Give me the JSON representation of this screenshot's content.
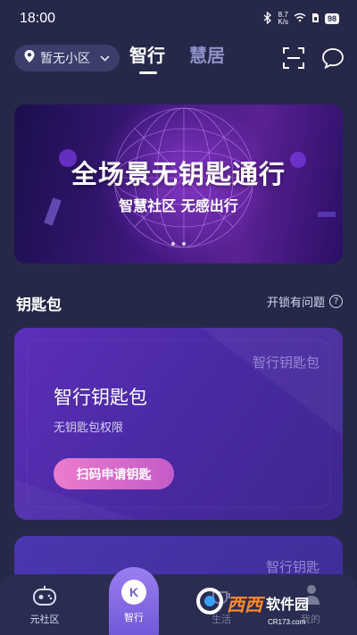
{
  "status_bar": {
    "time": "18:00",
    "speed_value": "8.7",
    "speed_unit": "K/s",
    "battery": "98"
  },
  "header": {
    "community": "暂无小区",
    "tabs": [
      {
        "label": "智行",
        "active": true
      },
      {
        "label": "慧居",
        "active": false
      }
    ],
    "icons": [
      "scan-icon",
      "message-icon"
    ]
  },
  "banner": {
    "title": "全场景无钥匙通行",
    "subtitle": "智慧社区 无感出行",
    "pages": 2
  },
  "key_wallet": {
    "section_title": "钥匙包",
    "help_label": "开锁有问题",
    "card": {
      "watermark": "智行钥匙包",
      "title": "智行钥匙包",
      "description": "无钥匙包权限",
      "button_label": "扫码申请钥匙"
    },
    "card2": {
      "watermark": "智行钥匙"
    }
  },
  "bottom_nav": {
    "items": [
      {
        "label": "元社区",
        "icon": "gamepad-icon"
      },
      {
        "label": "智行",
        "icon": "k-icon",
        "active": true
      },
      {
        "label": "生活",
        "icon": "cup-icon"
      },
      {
        "label": "我的",
        "icon": "person-icon"
      }
    ],
    "active_letter": "K"
  },
  "watermark": {
    "brand": "西西",
    "suffix": "软件园",
    "url": "CR173.com"
  },
  "colors": {
    "background": "#262849",
    "card": "#4b2aa6",
    "button": "#ec7ccd",
    "nav_active": "#7259d8"
  }
}
